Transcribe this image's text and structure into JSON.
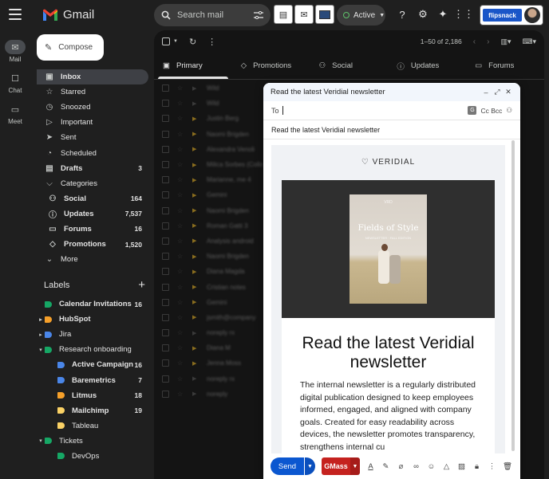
{
  "app": {
    "name": "Gmail"
  },
  "rail": [
    {
      "label": "Mail",
      "icon": "mail-icon",
      "glyph": "✉"
    },
    {
      "label": "Chat",
      "icon": "chat-icon",
      "glyph": "☐"
    },
    {
      "label": "Meet",
      "icon": "meet-icon",
      "glyph": "▭"
    }
  ],
  "search": {
    "placeholder": "Search mail"
  },
  "status": {
    "label": "Active"
  },
  "account": {
    "brand": "flipsnack"
  },
  "compose": {
    "label": "Compose"
  },
  "nav": [
    {
      "label": "Inbox",
      "icon": "inbox-icon",
      "glyph": "▣",
      "count": "",
      "bold": true,
      "selected": true
    },
    {
      "label": "Starred",
      "icon": "star-icon",
      "glyph": "☆",
      "count": ""
    },
    {
      "label": "Snoozed",
      "icon": "clock-icon",
      "glyph": "◷",
      "count": ""
    },
    {
      "label": "Important",
      "icon": "important-icon",
      "glyph": "▷",
      "count": ""
    },
    {
      "label": "Sent",
      "icon": "send-icon",
      "glyph": "➤",
      "count": ""
    },
    {
      "label": "Scheduled",
      "icon": "scheduled-icon",
      "glyph": "◔",
      "count": ""
    },
    {
      "label": "Drafts",
      "icon": "draft-icon",
      "glyph": "▤",
      "count": "3",
      "bold": true
    },
    {
      "label": "Categories",
      "icon": "label-icon",
      "glyph": "⌵",
      "count": ""
    },
    {
      "label": "Social",
      "icon": "people-icon",
      "glyph": "⚇",
      "count": "164",
      "bold": true,
      "sub": true
    },
    {
      "label": "Updates",
      "icon": "info-icon",
      "glyph": "ⓘ",
      "count": "7,537",
      "bold": true,
      "sub": true
    },
    {
      "label": "Forums",
      "icon": "forum-icon",
      "glyph": "▭",
      "count": "16",
      "bold": true,
      "sub": true
    },
    {
      "label": "Promotions",
      "icon": "tag-icon",
      "glyph": "◇",
      "count": "1,520",
      "bold": true,
      "sub": true
    },
    {
      "label": "More",
      "icon": "chevron-down-icon",
      "glyph": "⌄",
      "count": ""
    }
  ],
  "labels": {
    "heading": "Labels",
    "add": "+",
    "items": [
      {
        "label": "Calendar Invitations",
        "color": "#16a765",
        "count": "16",
        "bold": true,
        "caret": ""
      },
      {
        "label": "HubSpot",
        "color": "#f6a02a",
        "count": "",
        "bold": true,
        "caret": "▸"
      },
      {
        "label": "Jira",
        "color": "#4a86e8",
        "count": "",
        "caret": "▸"
      },
      {
        "label": "Research onboarding",
        "color": "#16a765",
        "count": "",
        "caret": "▾"
      },
      {
        "label": "Active Campaign",
        "color": "#4a86e8",
        "count": "16",
        "bold": true,
        "caret": "",
        "indent": true
      },
      {
        "label": "Baremetrics",
        "color": "#4a86e8",
        "count": "7",
        "bold": true,
        "caret": "",
        "indent": true
      },
      {
        "label": "Litmus",
        "color": "#f6a02a",
        "count": "18",
        "bold": true,
        "caret": "",
        "indent": true
      },
      {
        "label": "Mailchimp",
        "color": "#fad165",
        "count": "19",
        "bold": true,
        "caret": "",
        "indent": true
      },
      {
        "label": "Tableau",
        "color": "#fad165",
        "count": "",
        "caret": "",
        "indent": true
      },
      {
        "label": "Tickets",
        "color": "#16a765",
        "count": "",
        "caret": "▾"
      },
      {
        "label": "DevOps",
        "color": "#16a765",
        "count": "",
        "caret": "",
        "indent": true
      }
    ]
  },
  "list": {
    "range": "1–50 of 2,186",
    "tabs": [
      {
        "label": "Primary",
        "icon": "inbox-icon",
        "glyph": "▣"
      },
      {
        "label": "Promotions",
        "icon": "tag-icon",
        "glyph": "◇"
      },
      {
        "label": "Social",
        "icon": "people-icon",
        "glyph": "⚇"
      },
      {
        "label": "Updates",
        "icon": "info-icon",
        "glyph": "ⓘ"
      },
      {
        "label": "Forums",
        "icon": "forum-icon",
        "glyph": "▭"
      }
    ],
    "rows": [
      {
        "sender": "Wild",
        "important": false
      },
      {
        "sender": "Wild",
        "important": false
      },
      {
        "sender": "Justin Berg",
        "important": true
      },
      {
        "sender": "Naomi Brigden",
        "important": true
      },
      {
        "sender": "Alexandra Venoli",
        "important": true
      },
      {
        "sender": "Milica Sorbes (Collab)",
        "important": true
      },
      {
        "sender": "Marianne, me 4",
        "important": true
      },
      {
        "sender": "Gemini",
        "important": true
      },
      {
        "sender": "Naomi Brigden",
        "important": true
      },
      {
        "sender": "Roman Gatti 3",
        "important": true
      },
      {
        "sender": "Analysis android",
        "important": true
      },
      {
        "sender": "Naomi Brigden",
        "important": true
      },
      {
        "sender": "Diana Magda",
        "important": true
      },
      {
        "sender": "Cristian notes",
        "important": true
      },
      {
        "sender": "Gemini",
        "important": true
      },
      {
        "sender": "jsmith@company",
        "important": true
      },
      {
        "sender": "noreply rx",
        "important": false
      },
      {
        "sender": "Diana M",
        "important": true
      },
      {
        "sender": "Jenna Moss",
        "important": true
      },
      {
        "sender": "noreply rx",
        "important": false
      },
      {
        "sender": "noreply",
        "important": false
      }
    ]
  },
  "compose_window": {
    "title": "Read the latest Veridial newsletter",
    "to_label": "To",
    "cc_bcc": "Cc Bcc",
    "subject": "Read the latest Veridial newsletter",
    "brand_logo": "VERIDIAL",
    "cover": {
      "small": "VRD",
      "title": "Fields of Style",
      "sub": "NEWSLETTER · FALL EDITION"
    },
    "headline": "Read the latest Veridial newsletter",
    "body": "The internal newsletter is a regularly distributed digital publication designed to keep employees informed, engaged, and aligned with company goals. Created for easy readability across devices, the newsletter promotes transparency, strengthens internal cu",
    "send": "Send",
    "gmass": "GMass"
  }
}
